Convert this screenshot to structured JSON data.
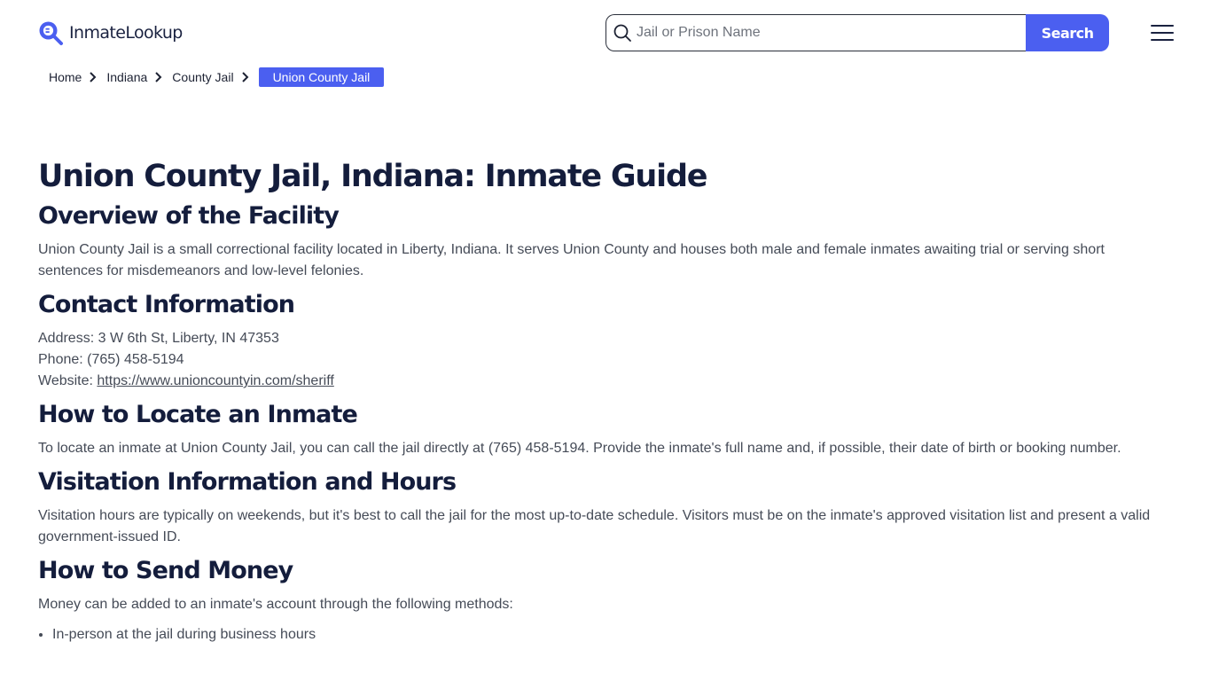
{
  "header": {
    "logo_text": "InmateLookup",
    "search": {
      "placeholder": "Jail or Prison Name",
      "value": "",
      "button_label": "Search"
    },
    "menu_icon": "hamburger-menu-icon"
  },
  "breadcrumb": {
    "items": [
      "Home",
      "Indiana",
      "County Jail"
    ],
    "current": "Union County Jail"
  },
  "colors": {
    "accent": "#4b5ff0",
    "heading": "#141d3c",
    "body_text": "#454b57"
  },
  "page": {
    "title": "Union County Jail, Indiana: Inmate Guide",
    "sections": [
      {
        "heading": "Overview of the Facility",
        "text": "Union County Jail is a small correctional facility located in Liberty, Indiana. It serves Union County and houses both male and female inmates awaiting trial or serving short sentences for misdemeanors and low-level felonies."
      },
      {
        "heading": "Contact Information",
        "address_label": "Address: ",
        "address": "3 W 6th St, Liberty, IN 47353",
        "phone_label": "Phone: ",
        "phone": "(765) 458-5194",
        "website_label": "Website: ",
        "website": "https://www.unioncountyin.com/sheriff"
      },
      {
        "heading": "How to Locate an Inmate",
        "text": "To locate an inmate at Union County Jail, you can call the jail directly at (765) 458-5194. Provide the inmate's full name and, if possible, their date of birth or booking number."
      },
      {
        "heading": "Visitation Information and Hours",
        "text": "Visitation hours are typically on weekends, but it's best to call the jail for the most up-to-date schedule. Visitors must be on the inmate's approved visitation list and present a valid government-issued ID."
      },
      {
        "heading": "How to Send Money",
        "text": "Money can be added to an inmate's account through the following methods:",
        "list": [
          "In-person at the jail during business hours"
        ]
      }
    ]
  }
}
